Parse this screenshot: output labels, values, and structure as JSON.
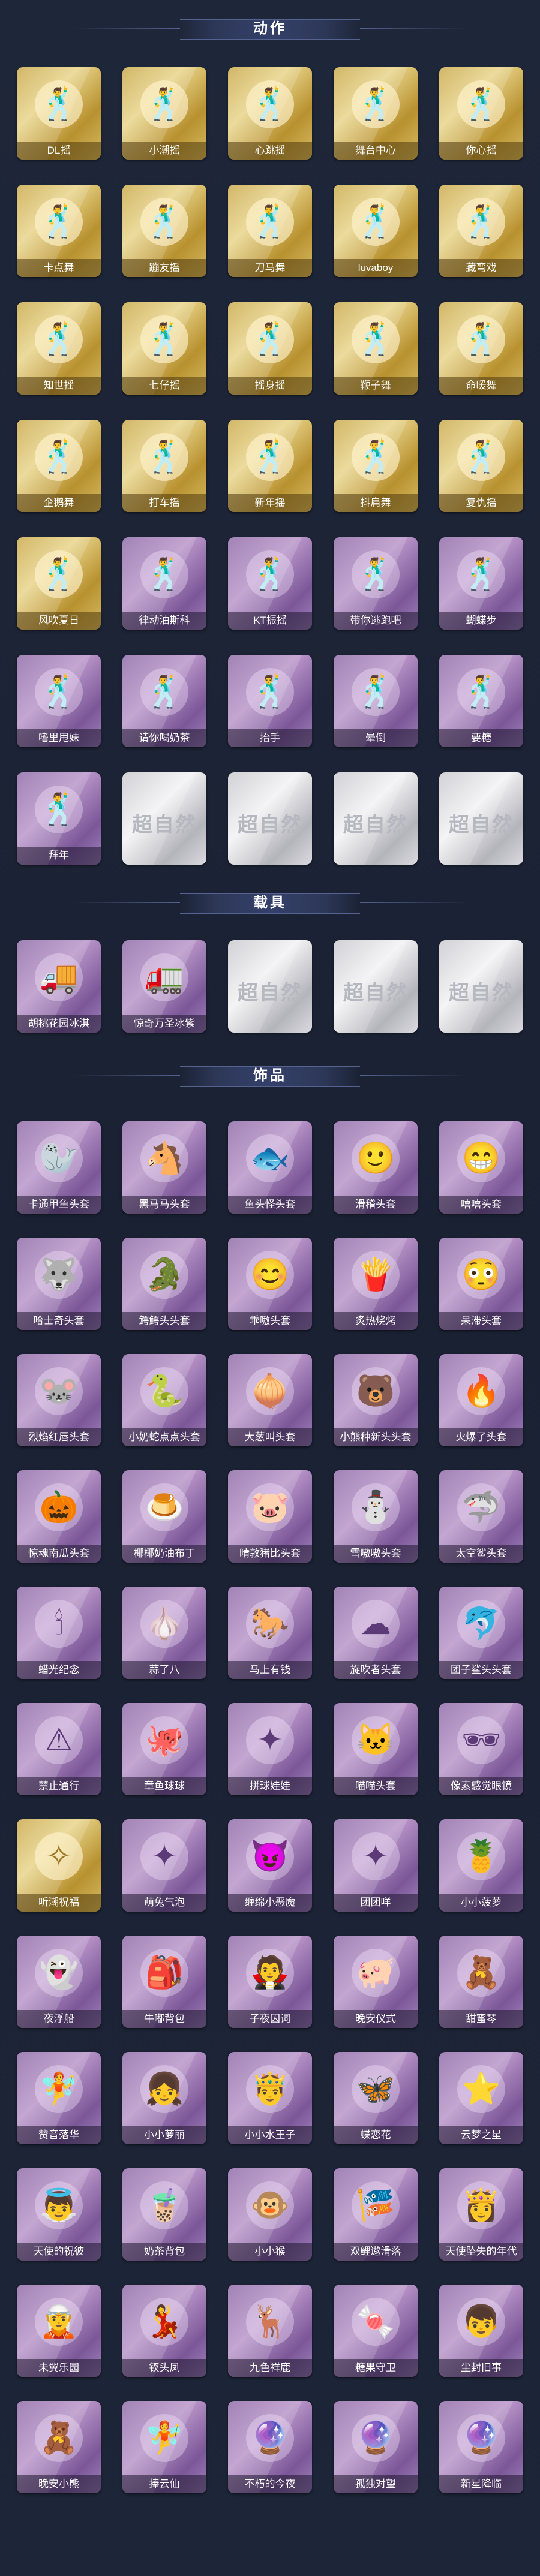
{
  "sections": [
    {
      "id": "actions",
      "title": "动作",
      "items": [
        {
          "label": "DL摇",
          "rarity": "gold",
          "icon": "dance-pose"
        },
        {
          "label": "小潮摇",
          "rarity": "gold",
          "icon": "dance-pose"
        },
        {
          "label": "心跳摇",
          "rarity": "gold",
          "icon": "dance-pose"
        },
        {
          "label": "舞台中心",
          "rarity": "gold",
          "icon": "dance-pose"
        },
        {
          "label": "你心摇",
          "rarity": "gold",
          "icon": "dance-pose"
        },
        {
          "label": "卡点舞",
          "rarity": "gold",
          "icon": "dance-pose"
        },
        {
          "label": "蹦友摇",
          "rarity": "gold",
          "icon": "dance-pose"
        },
        {
          "label": "刀马舞",
          "rarity": "gold",
          "icon": "dance-pose"
        },
        {
          "label": "luvaboy",
          "rarity": "gold",
          "icon": "dance-pose"
        },
        {
          "label": "藏弯戏",
          "rarity": "gold",
          "icon": "dance-pose"
        },
        {
          "label": "知世摇",
          "rarity": "gold",
          "icon": "dance-pose"
        },
        {
          "label": "七仔摇",
          "rarity": "gold",
          "icon": "dance-pose"
        },
        {
          "label": "摇身摇",
          "rarity": "gold",
          "icon": "dance-pose"
        },
        {
          "label": "鞭子舞",
          "rarity": "gold",
          "icon": "dance-pose"
        },
        {
          "label": "命暖舞",
          "rarity": "gold",
          "icon": "dance-pose"
        },
        {
          "label": "企鹅舞",
          "rarity": "gold",
          "icon": "dance-pose"
        },
        {
          "label": "打车摇",
          "rarity": "gold",
          "icon": "dance-pose"
        },
        {
          "label": "新年摇",
          "rarity": "gold",
          "icon": "dance-pose"
        },
        {
          "label": "抖肩舞",
          "rarity": "gold",
          "icon": "dance-pose"
        },
        {
          "label": "复仇摇",
          "rarity": "gold",
          "icon": "dance-pose"
        },
        {
          "label": "风吹夏日",
          "rarity": "gold",
          "icon": "dance-pose"
        },
        {
          "label": "律动油斯科",
          "rarity": "purple",
          "icon": "dance-pose"
        },
        {
          "label": "KT振摇",
          "rarity": "purple",
          "icon": "dance-pose"
        },
        {
          "label": "带你逃跑吧",
          "rarity": "purple",
          "icon": "dance-pose"
        },
        {
          "label": "蝴蝶步",
          "rarity": "purple",
          "icon": "dance-pose"
        },
        {
          "label": "嗜里甩妹",
          "rarity": "purple",
          "icon": "dance-pose"
        },
        {
          "label": "请你喝奶茶",
          "rarity": "purple",
          "icon": "dance-pose"
        },
        {
          "label": "抬手",
          "rarity": "purple",
          "icon": "dance-pose"
        },
        {
          "label": "晕倒",
          "rarity": "purple",
          "icon": "dance-pose"
        },
        {
          "label": "要糖",
          "rarity": "purple",
          "icon": "dance-pose"
        },
        {
          "label": "拜年",
          "rarity": "purple",
          "icon": "dance-pose"
        },
        {
          "label": "",
          "rarity": "silver",
          "logo": "超自然"
        },
        {
          "label": "",
          "rarity": "silver",
          "logo": "超自然"
        },
        {
          "label": "",
          "rarity": "silver",
          "logo": "超自然"
        },
        {
          "label": "",
          "rarity": "silver",
          "logo": "超自然"
        }
      ]
    },
    {
      "id": "vehicles",
      "title": "载具",
      "items": [
        {
          "label": "胡桃花园冰淇",
          "rarity": "purple",
          "icon": "ice-cream-truck"
        },
        {
          "label": "惊奇万圣冰紫",
          "rarity": "purple",
          "icon": "truck"
        },
        {
          "label": "",
          "rarity": "silver",
          "logo": "超自然"
        },
        {
          "label": "",
          "rarity": "silver",
          "logo": "超自然"
        },
        {
          "label": "",
          "rarity": "silver",
          "logo": "超自然"
        }
      ]
    },
    {
      "id": "accessories",
      "title": "饰品",
      "items": [
        {
          "label": "卡通甲鱼头套",
          "rarity": "purple",
          "icon": "seal-head"
        },
        {
          "label": "黑马马头套",
          "rarity": "purple",
          "icon": "horse-head"
        },
        {
          "label": "鱼头怪头套",
          "rarity": "purple",
          "icon": "fish-head"
        },
        {
          "label": "滑稽头套",
          "rarity": "purple",
          "icon": "smiley"
        },
        {
          "label": "嘻嘻头套",
          "rarity": "purple",
          "icon": "grin"
        },
        {
          "label": "哈士奇头套",
          "rarity": "purple",
          "icon": "husky-head"
        },
        {
          "label": "鳄鳄头头套",
          "rarity": "purple",
          "icon": "croc-head"
        },
        {
          "label": "乖嗷头套",
          "rarity": "purple",
          "icon": "emoji-face"
        },
        {
          "label": "炙热烧烤",
          "rarity": "purple",
          "icon": "fries-head"
        },
        {
          "label": "呆滞头套",
          "rarity": "purple",
          "icon": "shocked-face"
        },
        {
          "label": "烈焰红唇头套",
          "rarity": "purple",
          "icon": "pikachu-head"
        },
        {
          "label": "小奶蛇点点头套",
          "rarity": "purple",
          "icon": "snake-head"
        },
        {
          "label": "大葱叫头套",
          "rarity": "purple",
          "icon": "onion-head"
        },
        {
          "label": "小熊种新头头套",
          "rarity": "purple",
          "icon": "bear-head"
        },
        {
          "label": "火爆了头套",
          "rarity": "purple",
          "icon": "fire-head"
        },
        {
          "label": "惊魂南瓜头套",
          "rarity": "purple",
          "icon": "pumpkin-head"
        },
        {
          "label": "椰椰奶油布丁",
          "rarity": "purple",
          "icon": "pudding-head"
        },
        {
          "label": "晴敦猪比头套",
          "rarity": "purple",
          "icon": "pig-head"
        },
        {
          "label": "雪嗷嗷头套",
          "rarity": "purple",
          "icon": "snowman-head"
        },
        {
          "label": "太空鲨头套",
          "rarity": "purple",
          "icon": "shark-head"
        },
        {
          "label": "蜡光纪念",
          "rarity": "purple",
          "icon": "candle-head"
        },
        {
          "label": "蒜了八",
          "rarity": "purple",
          "icon": "garlic-head"
        },
        {
          "label": "马上有钱",
          "rarity": "purple",
          "icon": "horse-red"
        },
        {
          "label": "旋吹者头套",
          "rarity": "purple",
          "icon": "cloud-head"
        },
        {
          "label": "团子鲨头头套",
          "rarity": "purple",
          "icon": "shark-baby"
        },
        {
          "label": "禁止通行",
          "rarity": "purple",
          "icon": "warning-head"
        },
        {
          "label": "章鱼球球",
          "rarity": "purple",
          "icon": "octopus-head"
        },
        {
          "label": "拼球娃娃",
          "rarity": "purple",
          "icon": "blank"
        },
        {
          "label": "喵喵头套",
          "rarity": "purple",
          "icon": "cat-head"
        },
        {
          "label": "像素感觉眼镜",
          "rarity": "purple",
          "icon": "pixel-glasses"
        },
        {
          "label": "听潮祝福",
          "rarity": "gold",
          "icon": "spirit"
        },
        {
          "label": "萌兔气泡",
          "rarity": "purple",
          "icon": "blank"
        },
        {
          "label": "缠绵小恶魔",
          "rarity": "purple",
          "icon": "devil"
        },
        {
          "label": "团团咩",
          "rarity": "purple",
          "icon": "blank"
        },
        {
          "label": "小小菠萝",
          "rarity": "purple",
          "icon": "pineapple"
        },
        {
          "label": "夜浮船",
          "rarity": "purple",
          "icon": "ghost"
        },
        {
          "label": "牛嘟背包",
          "rarity": "purple",
          "icon": "backpack"
        },
        {
          "label": "子夜囚词",
          "rarity": "purple",
          "icon": "dark-doll"
        },
        {
          "label": "晚安仪式",
          "rarity": "purple",
          "icon": "pig-doll"
        },
        {
          "label": "甜蜜琴",
          "rarity": "purple",
          "icon": "pink-bear"
        },
        {
          "label": "赞音落华",
          "rarity": "purple",
          "icon": "fairy"
        },
        {
          "label": "小小萝丽",
          "rarity": "purple",
          "icon": "doll"
        },
        {
          "label": "小小水王子",
          "rarity": "purple",
          "icon": "prince"
        },
        {
          "label": "蝶恋花",
          "rarity": "purple",
          "icon": "butterfly"
        },
        {
          "label": "云梦之星",
          "rarity": "purple",
          "icon": "star-cloud"
        },
        {
          "label": "天使的祝彼",
          "rarity": "purple",
          "icon": "angel"
        },
        {
          "label": "奶茶背包",
          "rarity": "purple",
          "icon": "milk-tea"
        },
        {
          "label": "小小猴",
          "rarity": "purple",
          "icon": "monkey"
        },
        {
          "label": "双鲤遨滑落",
          "rarity": "purple",
          "icon": "koi"
        },
        {
          "label": "天使坠失的年代",
          "rarity": "purple",
          "icon": "angel-girl"
        },
        {
          "label": "未翼乐园",
          "rarity": "purple",
          "icon": "wing-girl"
        },
        {
          "label": "钗头凤",
          "rarity": "purple",
          "icon": "phoenix-girl"
        },
        {
          "label": "九色祥鹿",
          "rarity": "purple",
          "icon": "deer"
        },
        {
          "label": "糖果守卫",
          "rarity": "purple",
          "icon": "candy"
        },
        {
          "label": "尘封旧事",
          "rarity": "purple",
          "icon": "boy"
        },
        {
          "label": "晚安小熊",
          "rarity": "purple",
          "icon": "bear-charm"
        },
        {
          "label": "捧云仙",
          "rarity": "purple",
          "icon": "fairy-charm"
        },
        {
          "label": "不朽的今夜",
          "rarity": "purple",
          "icon": "charm"
        },
        {
          "label": "孤独对望",
          "rarity": "purple",
          "icon": "charm"
        },
        {
          "label": "新星降临",
          "rarity": "purple",
          "icon": "charm"
        }
      ]
    }
  ]
}
